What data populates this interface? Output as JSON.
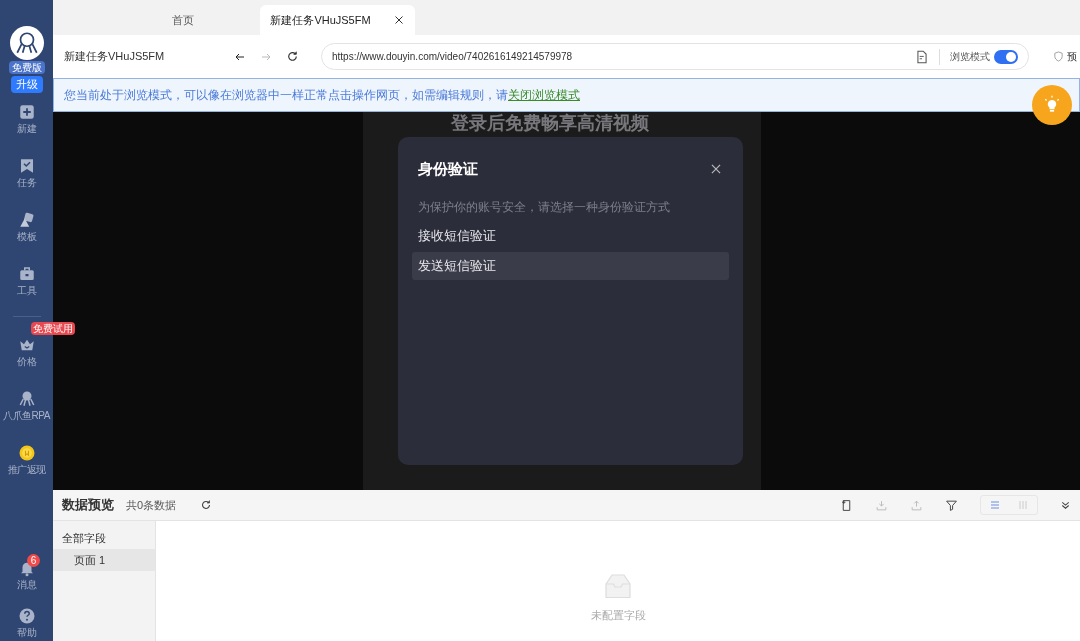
{
  "sidebar": {
    "plan": "免费版",
    "upgrade": "升级",
    "items": [
      {
        "kind": "new",
        "label": "新建"
      },
      {
        "kind": "task",
        "label": "任务"
      },
      {
        "kind": "template",
        "label": "模板"
      },
      {
        "kind": "tool",
        "label": "工具"
      },
      {
        "kind": "price",
        "label": "价格",
        "badge": "免费试用"
      },
      {
        "kind": "rpa",
        "label": "八爪鱼RPA"
      },
      {
        "kind": "coin",
        "label": "推广返现"
      }
    ],
    "bottom_items": [
      {
        "kind": "bell",
        "label": "消息",
        "badge": "6"
      },
      {
        "kind": "help",
        "label": "帮助"
      }
    ]
  },
  "tabs": [
    {
      "label": "首页",
      "selected": false,
      "closable": false
    },
    {
      "label": "新建任务VHuJS5FM",
      "selected": true,
      "closable": true
    }
  ],
  "address_bar": {
    "page_title": "新建任务VHuJS5FM",
    "url": "https://www.douyin.com/video/7402616149214579978",
    "browse_mode_label": "浏览模式",
    "browse_mode_on": true,
    "right_label": "预"
  },
  "notice": {
    "text": "您当前处于浏览模式，可以像在浏览器中一样正常点击操作网页，如需编辑规则，请",
    "link": "关闭浏览模式"
  },
  "web_page": {
    "heading": "登录后免费畅享高清视频",
    "dialog": {
      "title": "身份验证",
      "subtitle": "为保护你的账号安全，请选择一种身份验证方式",
      "options": [
        {
          "label": "接收短信验证",
          "selected": false
        },
        {
          "label": "发送短信验证",
          "selected": true
        }
      ]
    }
  },
  "data_preview": {
    "title": "数据预览",
    "count": "共0条数据",
    "fields": [
      {
        "label": "全部字段",
        "children": [
          {
            "label": "页面 1",
            "selected": true
          }
        ]
      }
    ],
    "empty_text": "未配置字段"
  }
}
